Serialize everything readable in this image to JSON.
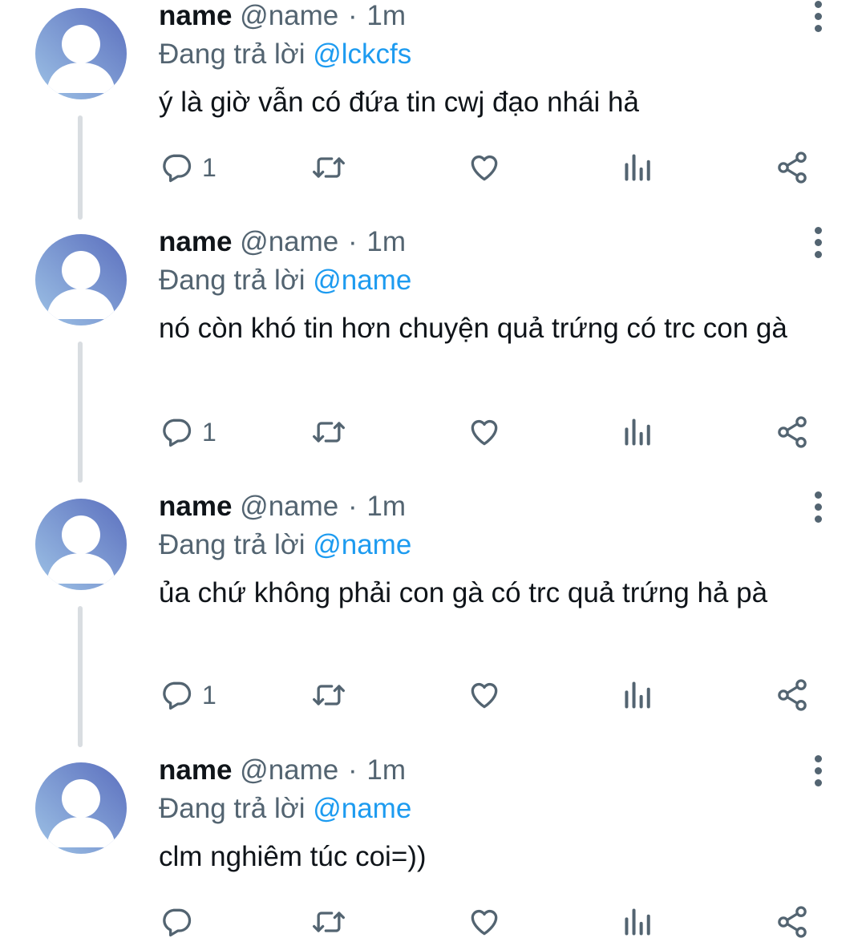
{
  "colors": {
    "name": "#0f1419",
    "meta": "#536471",
    "mention": "#1d9bf0",
    "avatar_gradient": [
      "#9ec3e6",
      "#5b6fbe"
    ],
    "thread_line": "#d9dde1"
  },
  "tweets": [
    {
      "display_name": "name",
      "handle": "@name",
      "separator": "·",
      "time": "1m",
      "replying_label": "Đang trả lời",
      "replying_to": "@lckcfs",
      "text": "ý là giờ vẫn có đứa tin cwj đạo nhái hả",
      "reply_count": "1",
      "icons": [
        "reply-icon",
        "retweet-icon",
        "like-icon",
        "views-icon",
        "share-icon"
      ]
    },
    {
      "display_name": "name",
      "handle": "@name",
      "separator": "·",
      "time": "1m",
      "replying_label": "Đang trả lời",
      "replying_to": "@name",
      "text": "nó còn khó tin hơn chuyện quả trứng có trc con gà",
      "reply_count": "1",
      "icons": [
        "reply-icon",
        "retweet-icon",
        "like-icon",
        "views-icon",
        "share-icon"
      ]
    },
    {
      "display_name": "name",
      "handle": "@name",
      "separator": "·",
      "time": "1m",
      "replying_label": "Đang trả lời",
      "replying_to": "@name",
      "text": "ủa chứ không phải con gà có trc quả trứng hả pà",
      "reply_count": "1",
      "icons": [
        "reply-icon",
        "retweet-icon",
        "like-icon",
        "views-icon",
        "share-icon"
      ]
    },
    {
      "display_name": "name",
      "handle": "@name",
      "separator": "·",
      "time": "1m",
      "replying_label": "Đang trả lời",
      "replying_to": "@name",
      "text": "clm nghiêm túc coi=))",
      "reply_count": "",
      "icons": [
        "reply-icon",
        "retweet-icon",
        "like-icon",
        "views-icon",
        "share-icon"
      ]
    }
  ]
}
